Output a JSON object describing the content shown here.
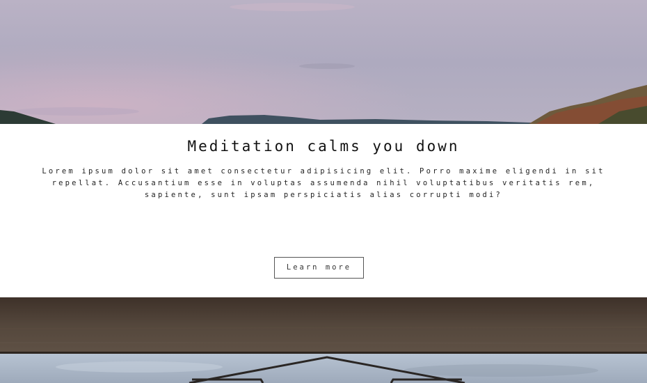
{
  "hero": {
    "image": "mountain-lake-dusk-photo"
  },
  "content": {
    "title": "Meditation calms you down",
    "text": "Lorem ipsum dolor sit amet consectetur adipisicing elit. Porro maxime eligendi in sit repellat. Accusantium esse in voluptas assumenda nihil voluptatibus veritatis rem, sapiente, sunt ipsam perspiciatis alias corrupti modi?",
    "button_label": "Learn more"
  },
  "bottom": {
    "image": "painted-arrow-on-wood-photo"
  },
  "colors": {
    "background": "#ffffff",
    "text": "#111111",
    "button_border": "#555555"
  }
}
